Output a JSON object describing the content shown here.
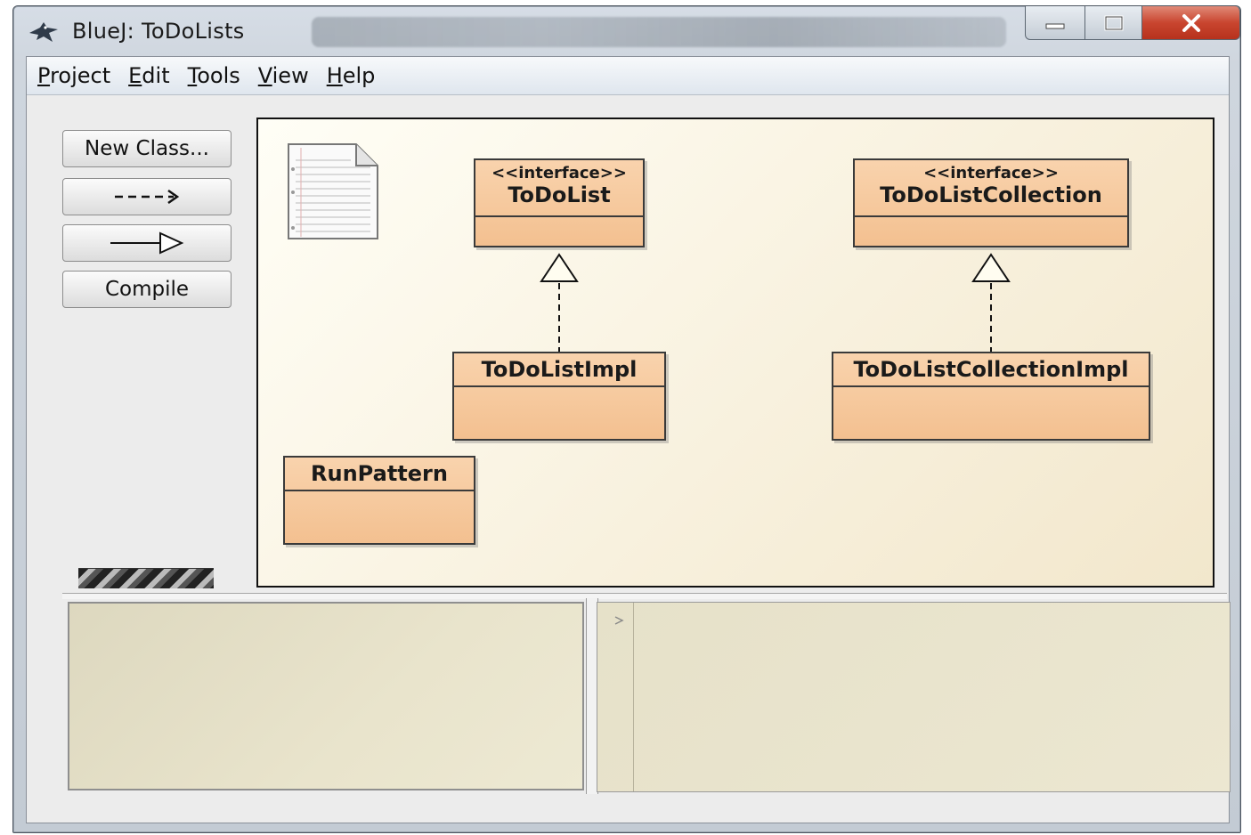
{
  "window": {
    "title": "BlueJ:  ToDoLists",
    "controls": {
      "minimize": "—",
      "maximize": "▢",
      "close": "✕"
    }
  },
  "menu": [
    {
      "accel": "P",
      "rest": "roject"
    },
    {
      "accel": "E",
      "rest": "dit"
    },
    {
      "accel": "T",
      "rest": "ools"
    },
    {
      "accel": "V",
      "rest": "iew"
    },
    {
      "accel": "H",
      "rest": "elp"
    }
  ],
  "toolbar": {
    "new_class": "New Class...",
    "compile": "Compile"
  },
  "diagram": {
    "classes": {
      "todolist": {
        "stereotype": "<<interface>>",
        "name": "ToDoList"
      },
      "todolistcollection": {
        "stereotype": "<<interface>>",
        "name": "ToDoListCollection"
      },
      "todolistimpl": {
        "name": "ToDoListImpl"
      },
      "todolistcollectionimpl": {
        "name": "ToDoListCollectionImpl"
      },
      "runpattern": {
        "name": "RunPattern"
      }
    },
    "colors": {
      "class_fill": "#f3c090",
      "canvas": "#f8f1de"
    }
  },
  "codepad": {
    "prompt_icon": "triangle-right-icon"
  }
}
